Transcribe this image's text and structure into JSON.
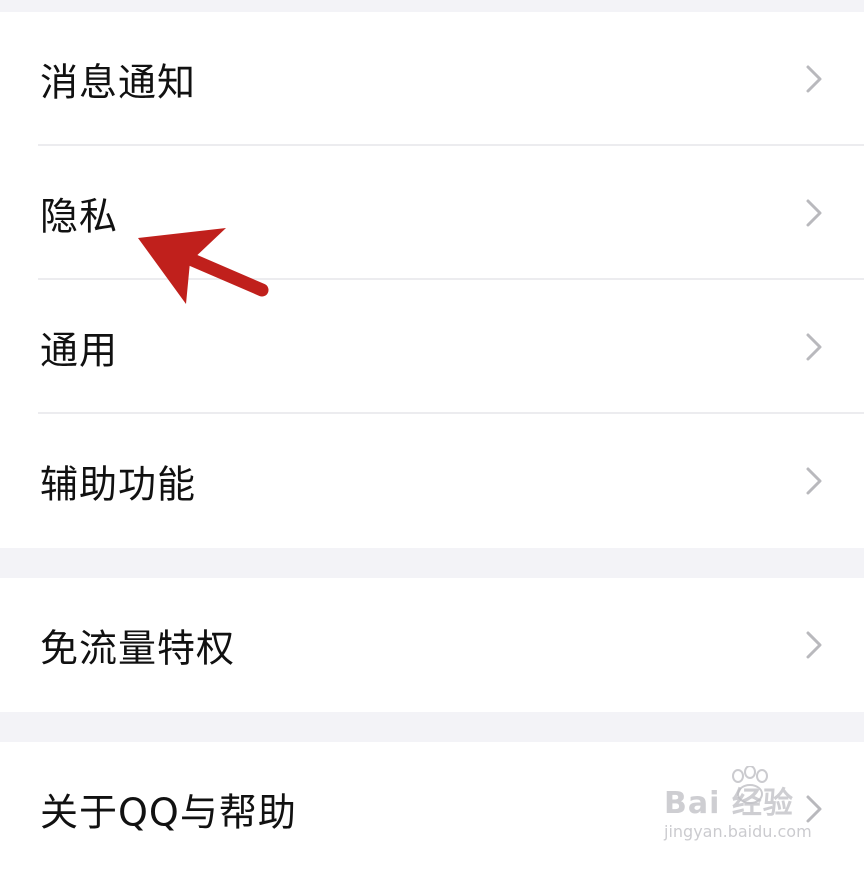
{
  "settings": {
    "group1": [
      {
        "label": "消息通知"
      },
      {
        "label": "隐私"
      },
      {
        "label": "通用"
      },
      {
        "label": "辅助功能"
      }
    ],
    "group2": [
      {
        "label": "免流量特权"
      }
    ],
    "group3": [
      {
        "label": "关于QQ与帮助"
      }
    ]
  },
  "watermark": {
    "logo_text": "Bai 经验",
    "url": "jingyan.baidu.com"
  },
  "colors": {
    "background": "#f3f3f7",
    "card": "#ffffff",
    "text": "#111111",
    "chevron": "#b9b9bd",
    "divider": "#ececef",
    "annotation_arrow": "#c0201c"
  }
}
